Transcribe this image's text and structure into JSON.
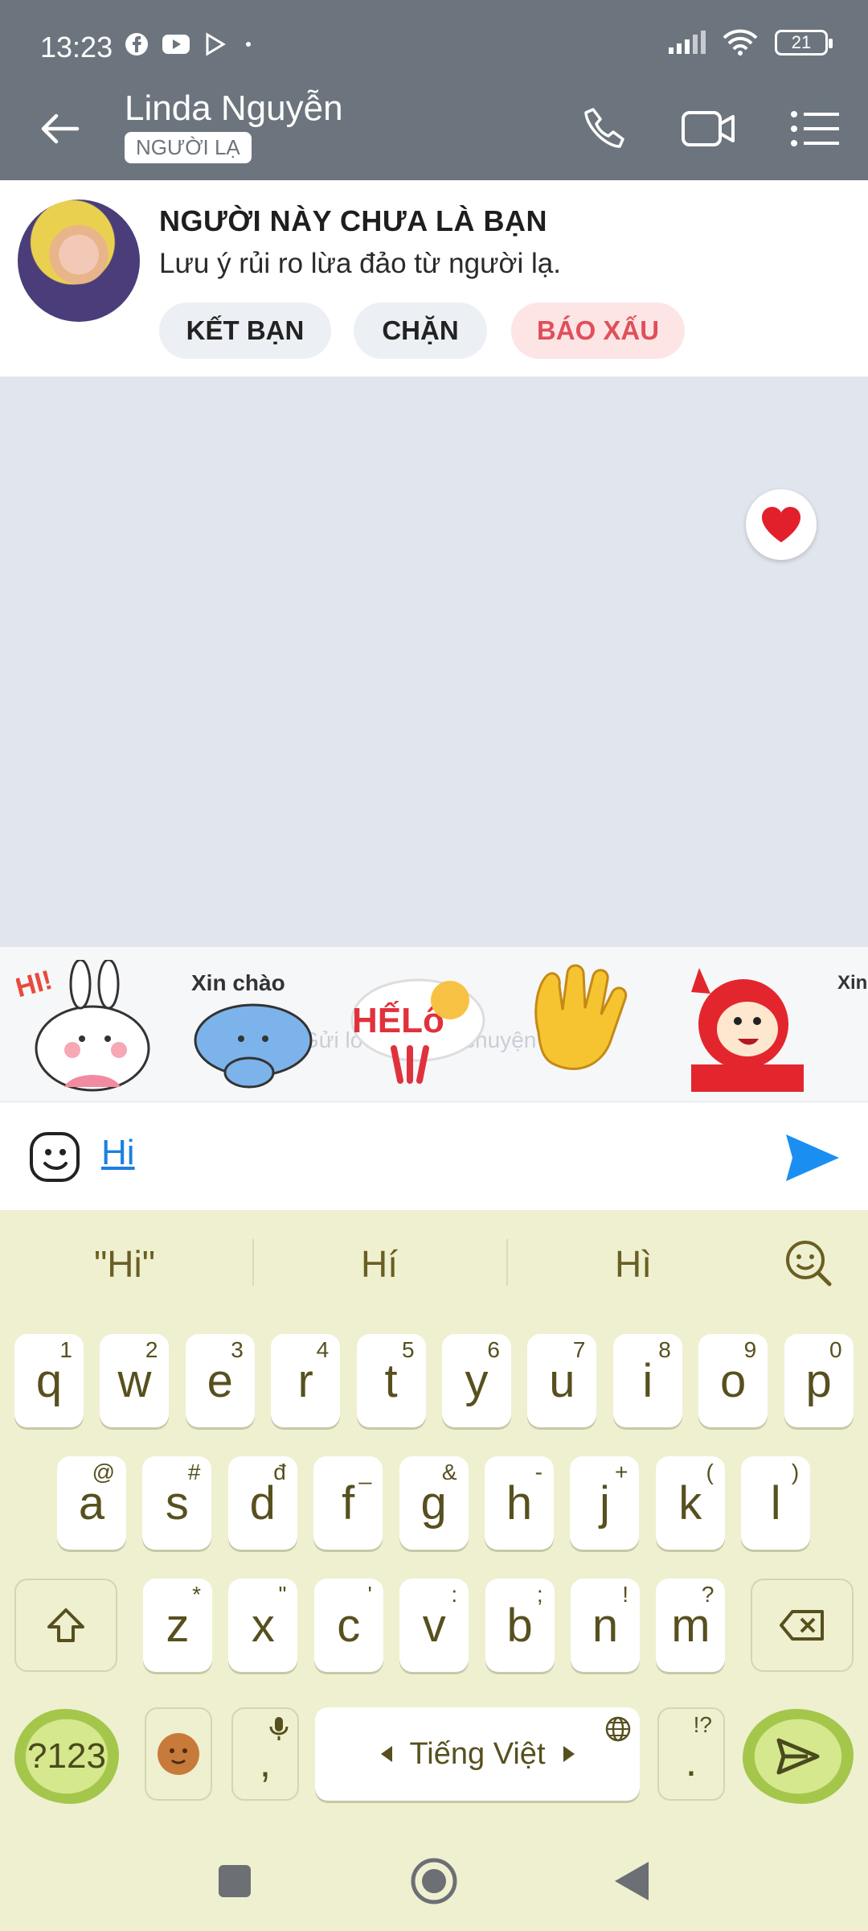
{
  "status_bar": {
    "time": "13:23",
    "battery": "21"
  },
  "header": {
    "contact_name": "Linda Nguyễn",
    "badge": "NGƯỜI LẠ"
  },
  "notice": {
    "title": "NGƯỜI NÀY CHƯA LÀ BẠN",
    "subtitle": "Lưu ý rủi ro lừa đảo từ người lạ.",
    "buttons": {
      "add_friend": "KẾT BẠN",
      "block": "CHẶN",
      "report": "BÁO XẤU"
    }
  },
  "stickers": {
    "items": [
      {
        "name": "bunny-hi",
        "text": "HI!"
      },
      {
        "name": "blue-cat-xin-chao",
        "text": "Xin chào"
      },
      {
        "name": "helo-sticker",
        "text": "HẾLô"
      },
      {
        "name": "waving-hand",
        "text": ""
      },
      {
        "name": "red-monkey",
        "text": ""
      },
      {
        "name": "xin-chao-partial",
        "text": "Xin Ch"
      }
    ],
    "ghost_text": "Gửi lời chào trò chuyện với"
  },
  "composer": {
    "message": "Hi"
  },
  "keyboard": {
    "suggestions": [
      "\"Hi\"",
      "Hí",
      "Hì"
    ],
    "row1": [
      {
        "k": "q",
        "h": "1"
      },
      {
        "k": "w",
        "h": "2"
      },
      {
        "k": "e",
        "h": "3"
      },
      {
        "k": "r",
        "h": "4"
      },
      {
        "k": "t",
        "h": "5"
      },
      {
        "k": "y",
        "h": "6"
      },
      {
        "k": "u",
        "h": "7"
      },
      {
        "k": "i",
        "h": "8"
      },
      {
        "k": "o",
        "h": "9"
      },
      {
        "k": "p",
        "h": "0"
      }
    ],
    "row2": [
      {
        "k": "a",
        "h": "@"
      },
      {
        "k": "s",
        "h": "#"
      },
      {
        "k": "d",
        "h": "đ"
      },
      {
        "k": "f",
        "h": "_"
      },
      {
        "k": "g",
        "h": "&"
      },
      {
        "k": "h",
        "h": "-"
      },
      {
        "k": "j",
        "h": "+"
      },
      {
        "k": "k",
        "h": "("
      },
      {
        "k": "l",
        "h": ")"
      }
    ],
    "row3": [
      {
        "k": "z",
        "h": "*"
      },
      {
        "k": "x",
        "h": "\""
      },
      {
        "k": "c",
        "h": "'"
      },
      {
        "k": "v",
        "h": ":"
      },
      {
        "k": "b",
        "h": ";"
      },
      {
        "k": "n",
        "h": "!"
      },
      {
        "k": "m",
        "h": "?"
      }
    ],
    "symbols_key": "?123",
    "comma_key": ",",
    "space_label": "Tiếng Việt",
    "period_key": ".",
    "period_hint": "!?"
  }
}
